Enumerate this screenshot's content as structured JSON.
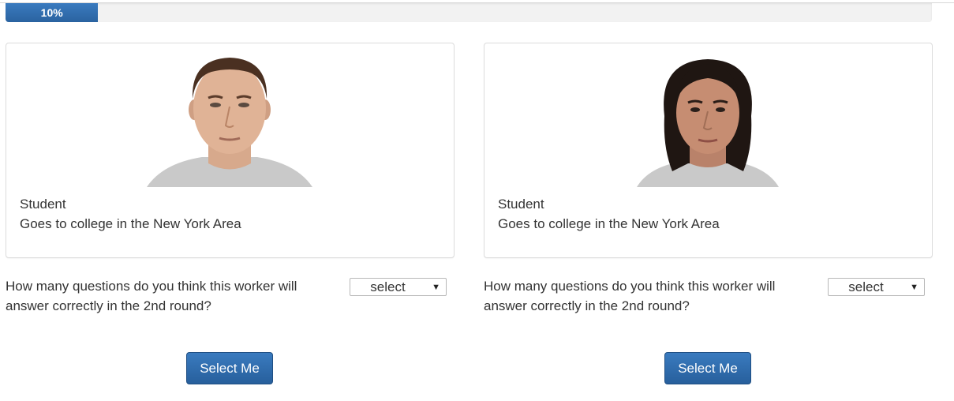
{
  "progress": {
    "label": "10%",
    "value": 0.1
  },
  "workers": [
    {
      "photo_icon": "male-portrait",
      "role": "Student",
      "description": "Goes to college in the New York Area",
      "question": "How many questions do you think this worker will answer correctly in the 2nd round?",
      "select_value": "select",
      "button_label": "Select Me"
    },
    {
      "photo_icon": "female-portrait",
      "role": "Student",
      "description": "Goes to college in the New York Area",
      "question": "How many questions do you think this worker will answer correctly in the 2nd round?",
      "select_value": "select",
      "button_label": "Select Me"
    }
  ],
  "colors": {
    "accent": "#2a63a0",
    "card_border": "#dcdcdc",
    "text": "#333333"
  }
}
